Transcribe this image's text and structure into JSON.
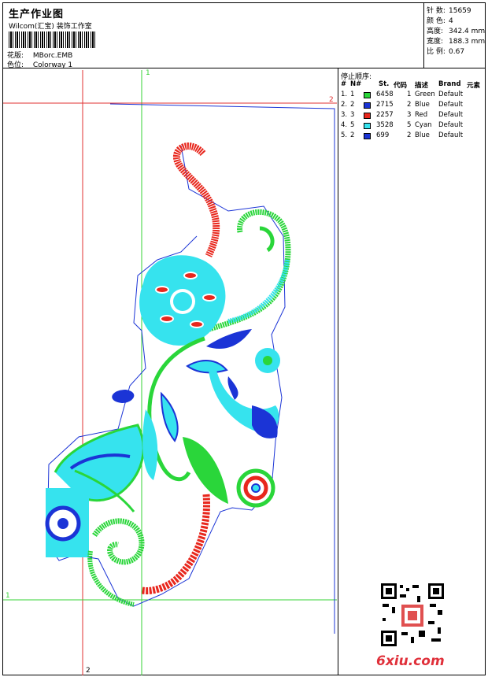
{
  "header": {
    "title": "生产作业图",
    "company": "Wilcom(汇宝) 装饰工作室",
    "design_label": "花版:",
    "design_value": "MBorc.EMB",
    "colorway_label": "色位:",
    "colorway_value": "Colorway 1"
  },
  "stats": [
    {
      "label": "针 数:",
      "value": "15659"
    },
    {
      "label": "颜 色:",
      "value": "4"
    },
    {
      "label": "高度:",
      "value": "342.4 mm"
    },
    {
      "label": "宽度:",
      "value": "188.3 mm"
    },
    {
      "label": "比 例:",
      "value": "0.67"
    }
  ],
  "stop_sequence": {
    "title": "停止顺序:",
    "columns": [
      "#",
      "N#",
      "St.",
      "代码",
      "描述",
      "Brand",
      "元素"
    ],
    "rows": [
      {
        "idx": "1.",
        "n": "1",
        "color": "#2ad63a",
        "st": "6458",
        "code": "1",
        "desc": "Green",
        "brand": "Default"
      },
      {
        "idx": "2.",
        "n": "2",
        "color": "#1b34d6",
        "st": "2715",
        "code": "2",
        "desc": "Blue",
        "brand": "Default"
      },
      {
        "idx": "3.",
        "n": "3",
        "color": "#e8271d",
        "st": "2257",
        "code": "3",
        "desc": "Red",
        "brand": "Default"
      },
      {
        "idx": "4.",
        "n": "5",
        "color": "#36e3ee",
        "st": "3528",
        "code": "5",
        "desc": "Cyan",
        "brand": "Default"
      },
      {
        "idx": "5.",
        "n": "2",
        "color": "#1b34d6",
        "st": "699",
        "code": "2",
        "desc": "Blue",
        "brand": "Default"
      }
    ]
  },
  "guides": {
    "v1": "1",
    "v2": "2",
    "h1": "1",
    "h2": "2"
  },
  "watermark": {
    "brand": "6xiu.com"
  },
  "colors": {
    "green": "#2ad63a",
    "blue": "#1b34d6",
    "red": "#e8271d",
    "cyan": "#36e3ee",
    "guide_green": "#36d336",
    "guide_red": "#e03030"
  }
}
